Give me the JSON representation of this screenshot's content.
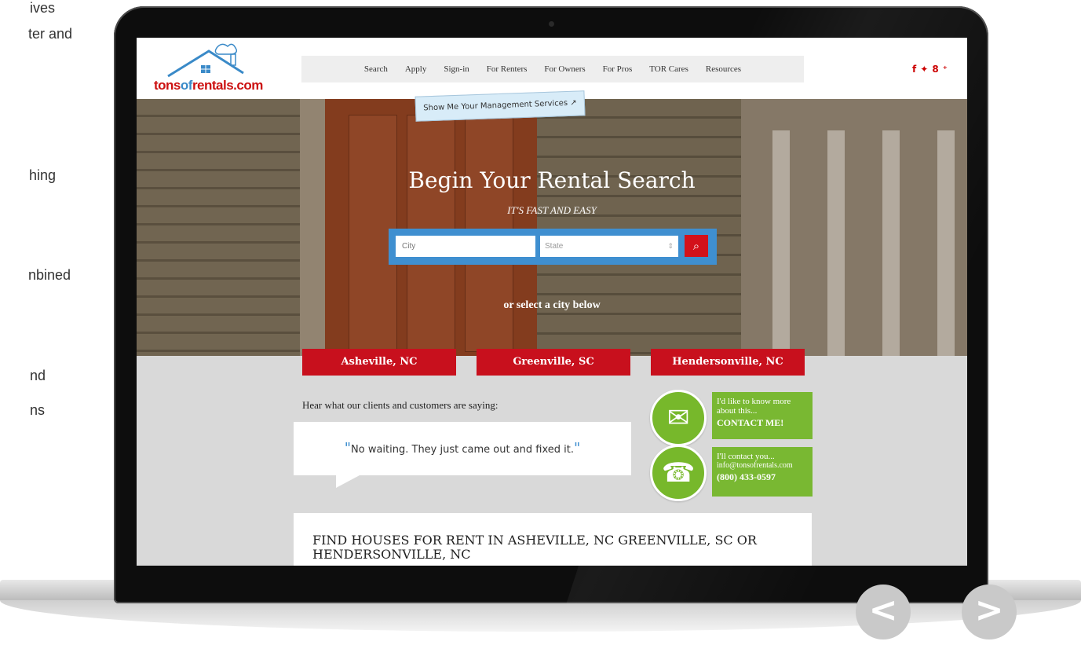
{
  "side_text": {
    "line1": "ives",
    "line2": "ter and",
    "line3": "hing",
    "line4": "nbined",
    "line5": "nd",
    "line6": "ns"
  },
  "site": {
    "logo_text_part1": "tons",
    "logo_text_part2": "of",
    "logo_text_part3": "rentals.com",
    "nav": [
      "Search",
      "Apply",
      "Sign-in",
      "For Renters",
      "For Owners",
      "For Pros",
      "TOR Cares",
      "Resources"
    ],
    "social": "f ✔ 8+",
    "management_note": "Show Me Your Management Services ↗",
    "hero_title": "Begin Your Rental Search",
    "hero_subtitle": "IT'S FAST AND EASY",
    "search": {
      "city_placeholder": "City",
      "state_placeholder": "State",
      "state_arrow": "⇕",
      "search_icon": "⌕"
    },
    "or_select": "or select a city below",
    "cities": [
      "Asheville, NC",
      "Greenville, SC",
      "Hendersonville, NC"
    ],
    "testimonials": {
      "heading": "Hear what our clients and customers are saying:",
      "quote": "No waiting. They just came out and fixed it."
    },
    "contact_card": {
      "line1": "I'd like to know more about this...",
      "cta": "CONTACT ME!"
    },
    "call_card": {
      "line1": "I'll contact you...",
      "email": "info@tonsofrentals.com",
      "phone": "(800) 433-0597"
    },
    "find_heading": "FIND HOUSES FOR RENT IN ASHEVILLE, NC GREENVILLE, SC OR HENDERSONVILLE, NC"
  },
  "carousel": {
    "prev": "<",
    "next": ">"
  },
  "icons": {
    "mail": "mail-icon",
    "phone": "phone-icon",
    "search": "search-icon",
    "facebook": "facebook-icon",
    "twitter": "twitter-icon",
    "googleplus": "googleplus-icon"
  }
}
